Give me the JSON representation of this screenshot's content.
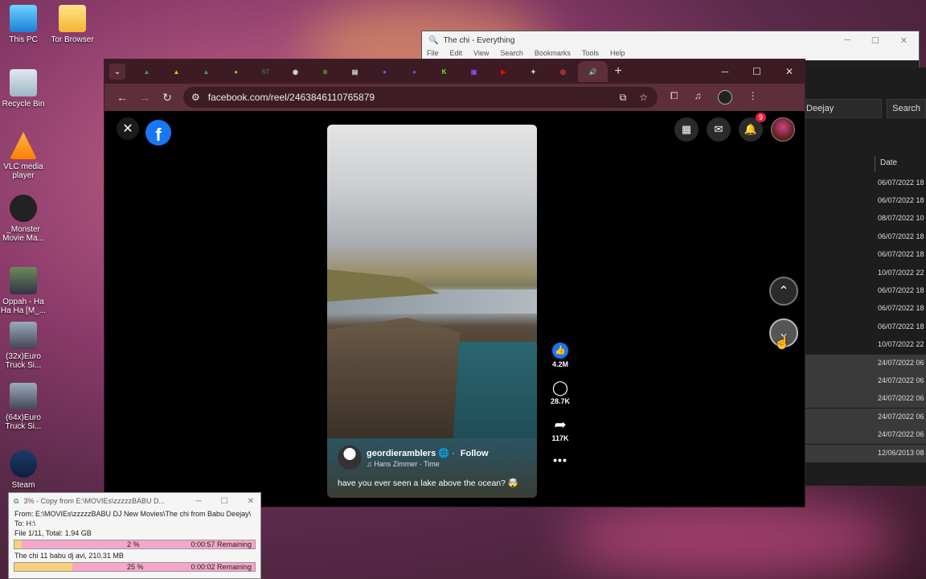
{
  "desktop": {
    "icons": [
      {
        "label": "This PC"
      },
      {
        "label": "Tor Browser"
      },
      {
        "label": "Recycle Bin"
      },
      {
        "label": "VLC media player"
      },
      {
        "label": "_Monster Movie Ma..."
      },
      {
        "label": "Oppah - Ha Ha Ha [M_..."
      },
      {
        "label": "(32x)Euro Truck Si..."
      },
      {
        "label": "(64x)Euro Truck Si..."
      },
      {
        "label": "Steam"
      }
    ]
  },
  "everything": {
    "title": "The chi - Everything",
    "menu": [
      "File",
      "Edit",
      "View",
      "Search",
      "Bookmarks",
      "Tools",
      "Help"
    ],
    "search_value": "Deejay",
    "search_button": "Search",
    "column_date": "Date",
    "rows": [
      "06/07/2022 18",
      "06/07/2022 18",
      "08/07/2022 10",
      "06/07/2022 18",
      "06/07/2022 18",
      "10/07/2022 22",
      "06/07/2022 18",
      "06/07/2022 18",
      "06/07/2022 18",
      "10/07/2022 22",
      "24/07/2022 06",
      "24/07/2022 06",
      "24/07/2022 06",
      "24/07/2022 06",
      "24/07/2022 06",
      "12/06/2013 08"
    ]
  },
  "browser": {
    "url": "facebook.com/reel/2463846110765879",
    "tabs": [
      {
        "icon": "▲",
        "color": "#34a853"
      },
      {
        "icon": "▲",
        "color": "#fbbc05"
      },
      {
        "icon": "▲",
        "color": "#34a853"
      },
      {
        "icon": "●",
        "color": "#8ac43f"
      },
      {
        "icon": "ST",
        "color": "#2f6e3f"
      },
      {
        "icon": "◉",
        "color": "#ddd"
      },
      {
        "icon": "⊛",
        "color": "#5d8a2e"
      },
      {
        "icon": "▤",
        "color": "#ddd"
      },
      {
        "icon": "●",
        "color": "#5865f2"
      },
      {
        "icon": "●",
        "color": "#6a4df0"
      },
      {
        "icon": "K",
        "color": "#53fc18"
      },
      {
        "icon": "▣",
        "color": "#9146ff"
      },
      {
        "icon": "▶",
        "color": "#ff0000"
      },
      {
        "icon": "✦",
        "color": "#ddd"
      },
      {
        "icon": "◎",
        "color": "#e44"
      },
      {
        "icon": "🔊",
        "color": "#ddd"
      }
    ]
  },
  "facebook": {
    "notifications_count": "9",
    "reel": {
      "username": "geordieramblers",
      "follow_label": "Follow",
      "music": "Hans Zimmer · Time",
      "caption": "have you ever seen a lake above the ocean? 🤯"
    },
    "actions": {
      "likes": "4.2M",
      "comments": "28.7K",
      "shares": "117K"
    }
  },
  "copy_dialog": {
    "title": "3% - Copy from E:\\MOVIEs\\zzzzzBABU D...",
    "from": "From:  E:\\MOVIEs\\zzzzzBABU DJ New Movies\\The chi from Babu Deejay\\",
    "to": "To:       H:\\",
    "file_info": "File 1/11, Total: 1.94 GB",
    "bar1_mid": "2 %",
    "bar1_right": "0:00:57 Remaining",
    "file_name": "The chi 11 babu dj avi, 210.31 MB",
    "bar2_mid": "25 %",
    "bar2_right": "0:00:02 Remaining"
  }
}
